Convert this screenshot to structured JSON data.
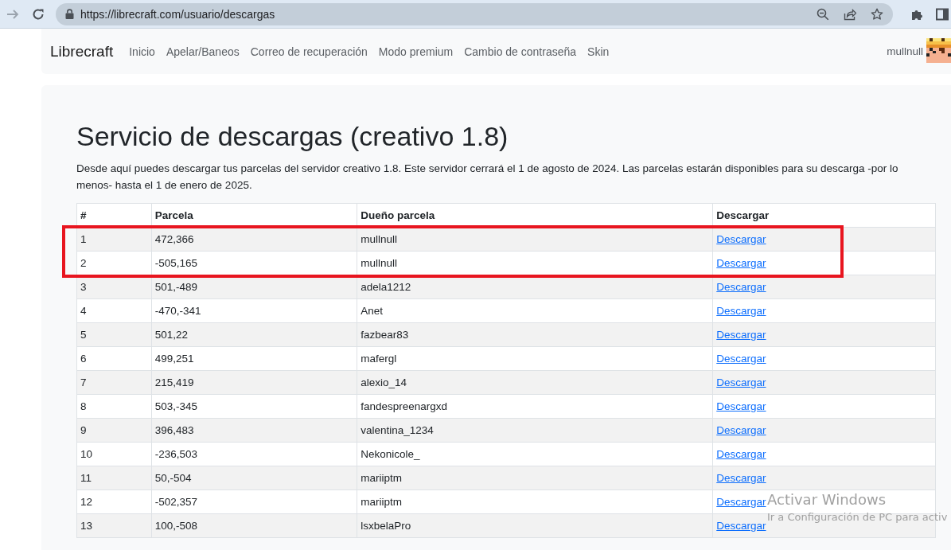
{
  "browser": {
    "url": "https://librecraft.com/usuario/descargas"
  },
  "navbar": {
    "brand": "Librecraft",
    "links": [
      "Inicio",
      "Apelar/Baneos",
      "Correo de recuperación",
      "Modo premium",
      "Cambio de contraseña",
      "Skin"
    ],
    "user": "mullnull"
  },
  "page": {
    "title": "Servicio de descargas (creativo 1.8)",
    "description": "Desde aquí puedes descargar tus parcelas del servidor creativo 1.8. Este servidor cerrará el 1 de agosto de 2024. Las parcelas estarán disponibles para su descarga -por lo menos- hasta el 1 de enero de 2025."
  },
  "table": {
    "columns": [
      "#",
      "Parcela",
      "Dueño parcela",
      "Descargar"
    ],
    "rows": [
      {
        "number": "1",
        "parcel": "472,366",
        "owner": "mullnull",
        "link": "Descargar",
        "highlighted": true
      },
      {
        "number": "2",
        "parcel": "-505,165",
        "owner": "mullnull",
        "link": "Descargar",
        "highlighted": true
      },
      {
        "number": "3",
        "parcel": "501,-489",
        "owner": "adela1212",
        "link": "Descargar",
        "highlighted": false
      },
      {
        "number": "4",
        "parcel": "-470,-341",
        "owner": "Anet",
        "link": "Descargar",
        "highlighted": false
      },
      {
        "number": "5",
        "parcel": "501,22",
        "owner": "fazbear83",
        "link": "Descargar",
        "highlighted": false
      },
      {
        "number": "6",
        "parcel": "499,251",
        "owner": "mafergl",
        "link": "Descargar",
        "highlighted": false
      },
      {
        "number": "7",
        "parcel": "215,419",
        "owner": "alexio_14",
        "link": "Descargar",
        "highlighted": false
      },
      {
        "number": "8",
        "parcel": "503,-345",
        "owner": "fandespreenargxd",
        "link": "Descargar",
        "highlighted": false
      },
      {
        "number": "9",
        "parcel": "396,483",
        "owner": "valentina_1234",
        "link": "Descargar",
        "highlighted": false
      },
      {
        "number": "10",
        "parcel": "-236,503",
        "owner": "Nekonicole_",
        "link": "Descargar",
        "highlighted": false
      },
      {
        "number": "11",
        "parcel": "50,-504",
        "owner": "mariiptm",
        "link": "Descargar",
        "highlighted": false
      },
      {
        "number": "12",
        "parcel": "-502,357",
        "owner": "mariiptm",
        "link": "Descargar",
        "highlighted": false
      },
      {
        "number": "13",
        "parcel": "100,-508",
        "owner": "lsxbelaPro",
        "link": "Descargar",
        "highlighted": false
      }
    ]
  },
  "windows_notice": {
    "title": "Activar Windows",
    "subtitle": "Ir a Configuración de PC para activ"
  }
}
